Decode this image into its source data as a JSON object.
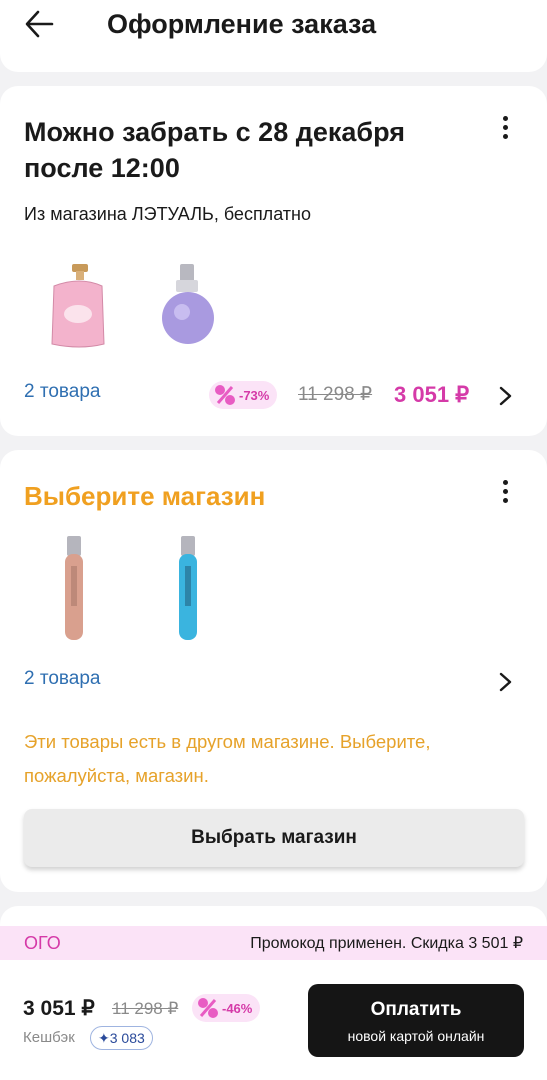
{
  "header": {
    "title": "Оформление заказа",
    "back_icon": "arrow-left-icon"
  },
  "pickup_group": {
    "title": "Можно забрать с 28 декабря после 12:00",
    "subtitle": "Из магазина ЛЭТУАЛЬ, бесплатно",
    "items_count": "2 товара",
    "discount_badge": "-73%",
    "old_price": "11 298 ₽",
    "new_price": "3 051 ₽"
  },
  "store_group": {
    "title": "Выберите магазин",
    "items_count": "2 товара",
    "warning": "Эти товары есть в другом магазине. Выберите, пожалуйста, магазин.",
    "choose_button": "Выбрать магазин"
  },
  "promo": {
    "code": "ОГО",
    "message": "Промокод применен. Скидка 3 501 ₽"
  },
  "footer": {
    "total": "3 051 ₽",
    "old_total": "11 298 ₽",
    "discount_badge": "-46%",
    "cashback_label": "Кешбэк",
    "cashback_value": "✦3 083",
    "pay_button": "Оплатить",
    "pay_subtitle": "новой картой онлайн"
  },
  "colors": {
    "accent_pink": "#d53aa8",
    "warning_orange": "#f0a020",
    "link_blue": "#2f6fb1"
  }
}
